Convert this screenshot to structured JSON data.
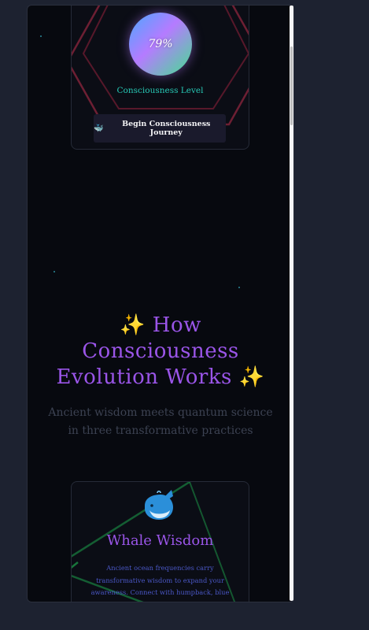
{
  "consciousness": {
    "level_text": "79%",
    "level_value": 0.79,
    "label": "Consciousness Level",
    "button_icon": "whale-emoji-icon",
    "button_label": "Begin Consciousness Journey"
  },
  "how_it_works": {
    "title_text": "How Consciousness Evolution Works",
    "sparkle_glyph": "✨",
    "subtitle": "Ancient wisdom meets quantum science in three transformative practices"
  },
  "cards": [
    {
      "icon": "whale-icon",
      "title": "Whale Wisdom",
      "description": "Ancient ocean frequencies carry transformative wisdom to expand your awareness. Connect with humpback, blue whale, orca, and gray whale"
    }
  ],
  "colors": {
    "accent_purple": "#9a55e8",
    "accent_teal": "#27c8b5",
    "neon_red": "#c0304d",
    "neon_green": "#1ea24c",
    "background": "#07090f"
  }
}
